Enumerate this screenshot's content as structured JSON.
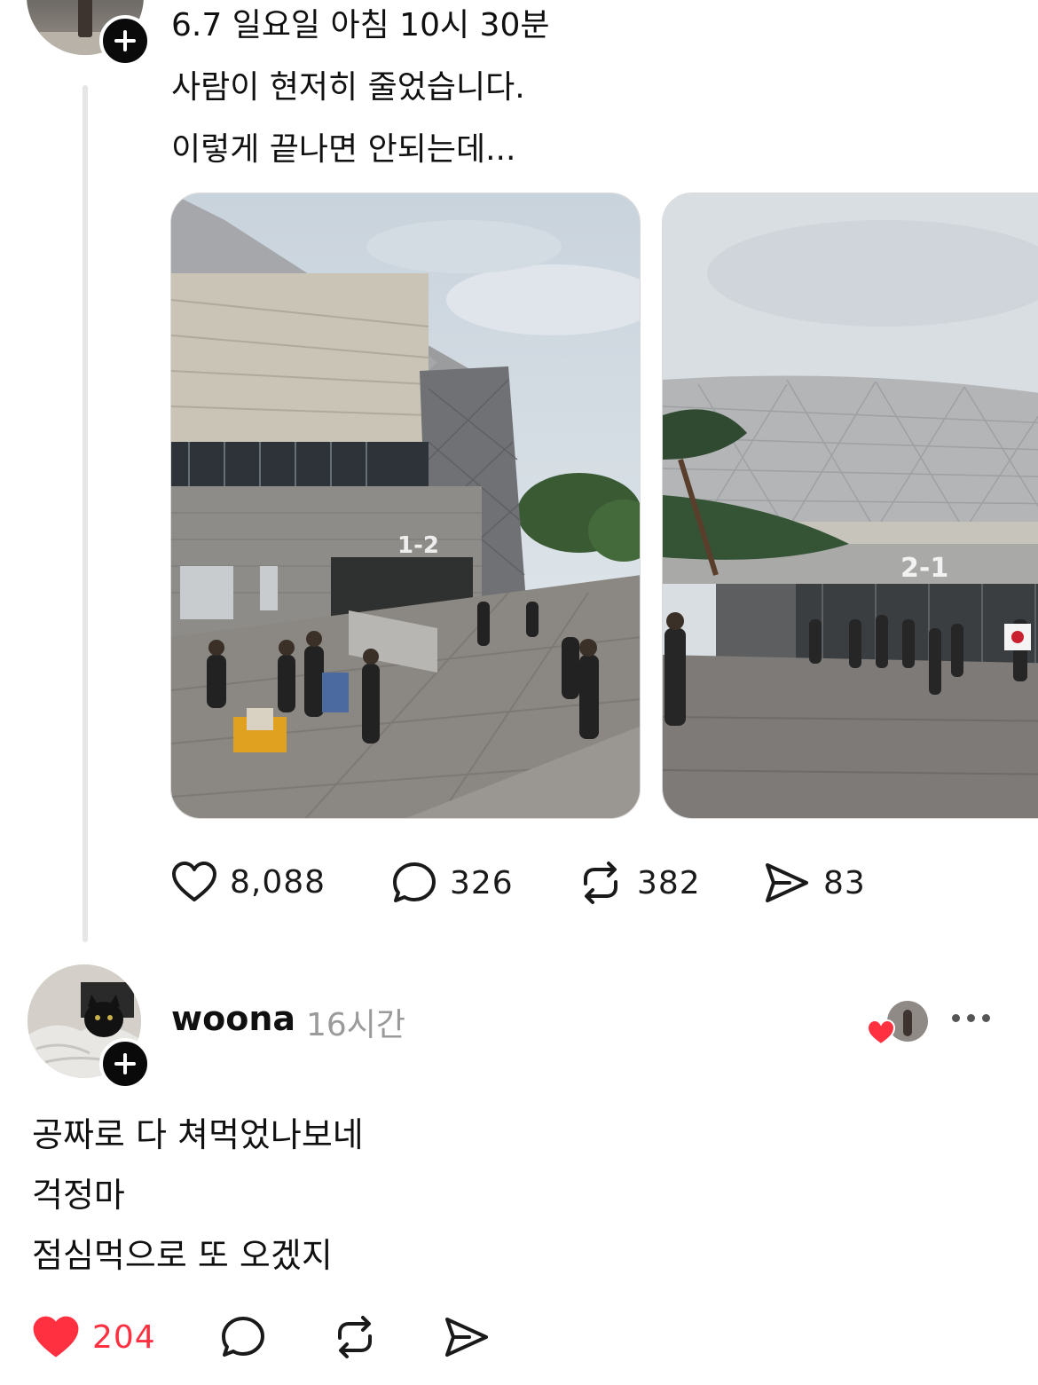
{
  "post": {
    "text_lines": [
      "6.7 일요일 아침 10시 30분",
      "사람이 현저히 줄었습니다.",
      "이렇게 끝나면 안되는데..."
    ],
    "actions": {
      "likes": "8,088",
      "comments": "326",
      "reposts": "382",
      "shares": "83"
    },
    "images": [
      {
        "gate_sign": "1-2"
      },
      {
        "gate_sign": "2-1"
      }
    ]
  },
  "reply": {
    "username": "woona",
    "time": "16시간",
    "text_lines": [
      "공짜로 다 쳐먹었나보네",
      "걱정마",
      "점심먹으로 또 오겠지"
    ],
    "actions": {
      "likes": "204"
    }
  },
  "colors": {
    "like_active": "#ff3040",
    "text": "#101010",
    "muted": "#9a9a9a",
    "thread_line": "#e6e6e6"
  },
  "icons": [
    "follow-plus-icon",
    "heart-icon",
    "comment-icon",
    "repost-icon",
    "share-icon",
    "more-icon"
  ]
}
